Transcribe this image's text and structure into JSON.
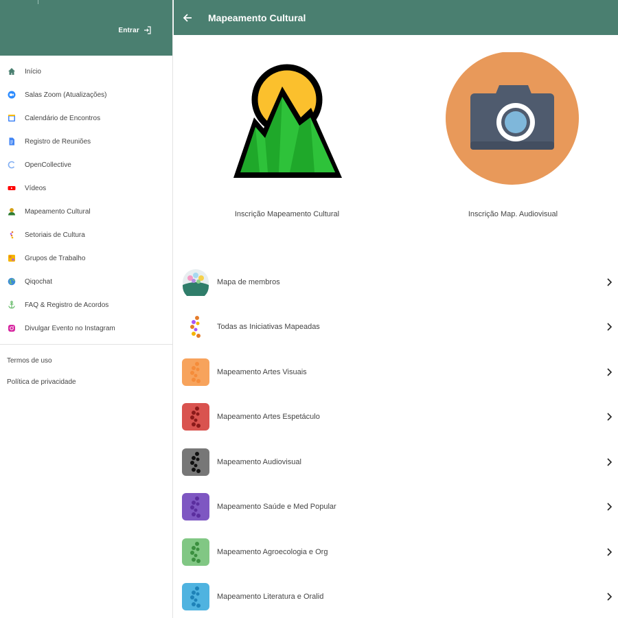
{
  "header": {
    "login_label": "Entrar",
    "title": "Mapeamento Cultural"
  },
  "sidebar": {
    "items": [
      {
        "label": "Início",
        "icon": "home-icon",
        "color": "#4a7f70"
      },
      {
        "label": "Salas Zoom (Atualizações)",
        "icon": "zoom-icon",
        "color": "#2d8cff"
      },
      {
        "label": "Calendário de Encontros",
        "icon": "calendar-icon",
        "color": "#4285f4"
      },
      {
        "label": "Registro de Reuniões",
        "icon": "document-icon",
        "color": "#4285f4"
      },
      {
        "label": "OpenCollective",
        "icon": "opencollective-icon",
        "color": "#7fadf2"
      },
      {
        "label": "Vídeos",
        "icon": "youtube-icon",
        "color": "#ff0000"
      },
      {
        "label": "Mapeamento Cultural",
        "icon": "person-icon",
        "color": "#2e7d32"
      },
      {
        "label": "Setoriais de Cultura",
        "icon": "setoriais-icon",
        "color": "#e57c2a"
      },
      {
        "label": "Grupos de Trabalho",
        "icon": "groups-icon",
        "color": "#f5b400"
      },
      {
        "label": "Qiqochat",
        "icon": "globe-icon",
        "color": "#3b8bd9"
      },
      {
        "label": "FAQ & Registro de Acordos",
        "icon": "anchor-icon",
        "color": "#4caf50"
      },
      {
        "label": "Divulgar Evento no Instagram",
        "icon": "instagram-icon",
        "color": "#d6249f"
      }
    ],
    "legal": [
      "Termos de uso",
      "Política de privacidade"
    ]
  },
  "cards": [
    {
      "label": "Inscrição Mapeamento Cultural",
      "icon": "mountain-sun-icon"
    },
    {
      "label": "Inscrição Map. Audiovisual",
      "icon": "camera-icon"
    }
  ],
  "list": [
    {
      "label": "Mapa de membros",
      "icon": "members-map-icon",
      "color": "#ffffff"
    },
    {
      "label": "Todas as Iniciativas Mapeadas",
      "icon": "all-initiatives-icon",
      "color": "#ffffff"
    },
    {
      "label": "Mapeamento Artes Visuais",
      "icon": "artes-visuais-icon",
      "color": "#f7a35c"
    },
    {
      "label": "Mapeamento Artes Espetáculo",
      "icon": "artes-espetaculo-icon",
      "color": "#d9534f"
    },
    {
      "label": "Mapeamento Audiovisual",
      "icon": "audiovisual-icon",
      "color": "#777777"
    },
    {
      "label": "Mapeamento Saúde e Med Popular",
      "icon": "saude-icon",
      "color": "#7e57c2"
    },
    {
      "label": "Mapeamento Agroecologia e Org",
      "icon": "agroecologia-icon",
      "color": "#81c784"
    },
    {
      "label": "Mapeamento Literatura e Oralid",
      "icon": "literatura-icon",
      "color": "#4fb3e0"
    }
  ]
}
